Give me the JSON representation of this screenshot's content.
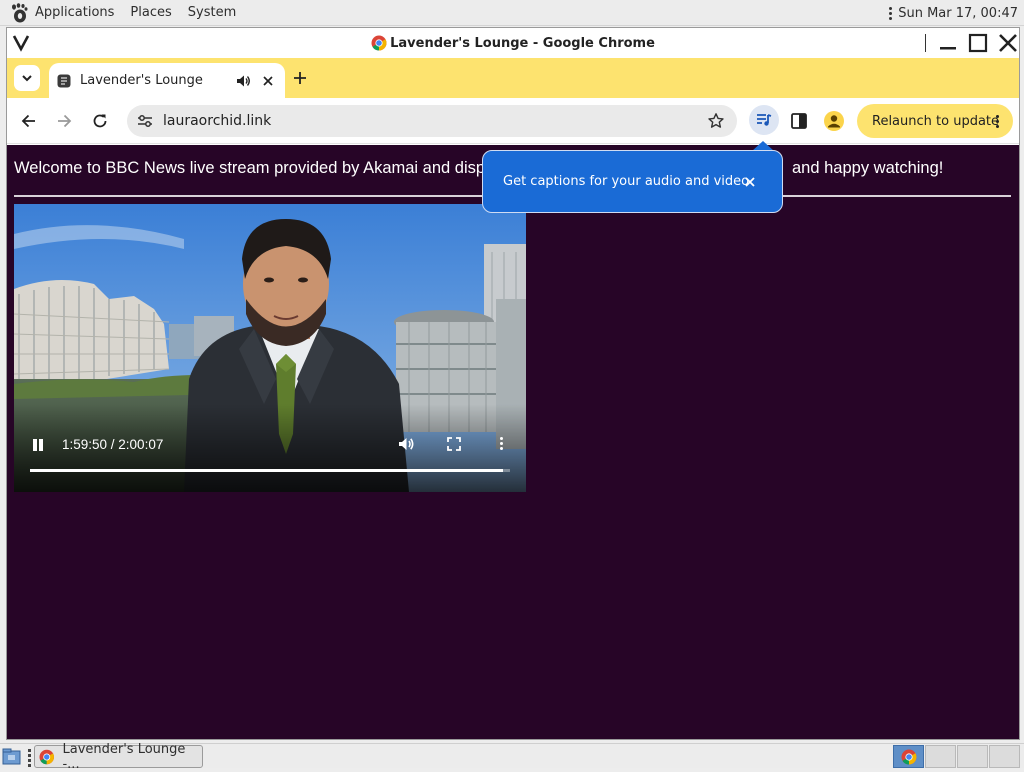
{
  "top_panel": {
    "menus": [
      "Applications",
      "Places",
      "System"
    ],
    "datetime": "Sun Mar 17, 00:47"
  },
  "window": {
    "title": "Lavender's Lounge - Google Chrome"
  },
  "tabs": [
    {
      "title": "Lavender's Lounge",
      "audio": true
    }
  ],
  "toolbar": {
    "url": "lauraorchid.link",
    "relaunch_label": "Relaunch to update"
  },
  "page": {
    "welcome_left": "Welcome to BBC News live stream provided by Akamai and displa",
    "welcome_right": "and happy watching!",
    "video": {
      "time": "1:59:50 / 2:00:07",
      "progress": 0.986,
      "state": "playing"
    }
  },
  "caption_bubble": {
    "text": "Get captions for your audio and video"
  },
  "taskbar": {
    "task_label": "Lavender's Lounge -...",
    "workspaces": 4,
    "active_workspace": 1
  },
  "colors": {
    "tabstrip": "#fde36f",
    "page_bg": "#270527",
    "bubble": "#1a6bd6"
  }
}
